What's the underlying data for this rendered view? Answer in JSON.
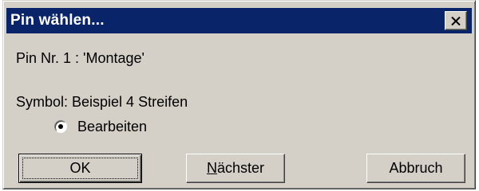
{
  "window": {
    "title": "Pin wählen...",
    "close_label": "×"
  },
  "content": {
    "pin_info": "Pin Nr. 1 : 'Montage'",
    "symbol_info": "Symbol: Beispiel 4 Streifen",
    "radio_label": "Bearbeiten",
    "radio_checked": true
  },
  "buttons": {
    "ok": "OK",
    "next_mnemonic": "N",
    "next_rest": "ächster",
    "cancel": "Abbruch"
  },
  "colors": {
    "titlebar": "#0a246a",
    "face": "#d4d0c8"
  }
}
